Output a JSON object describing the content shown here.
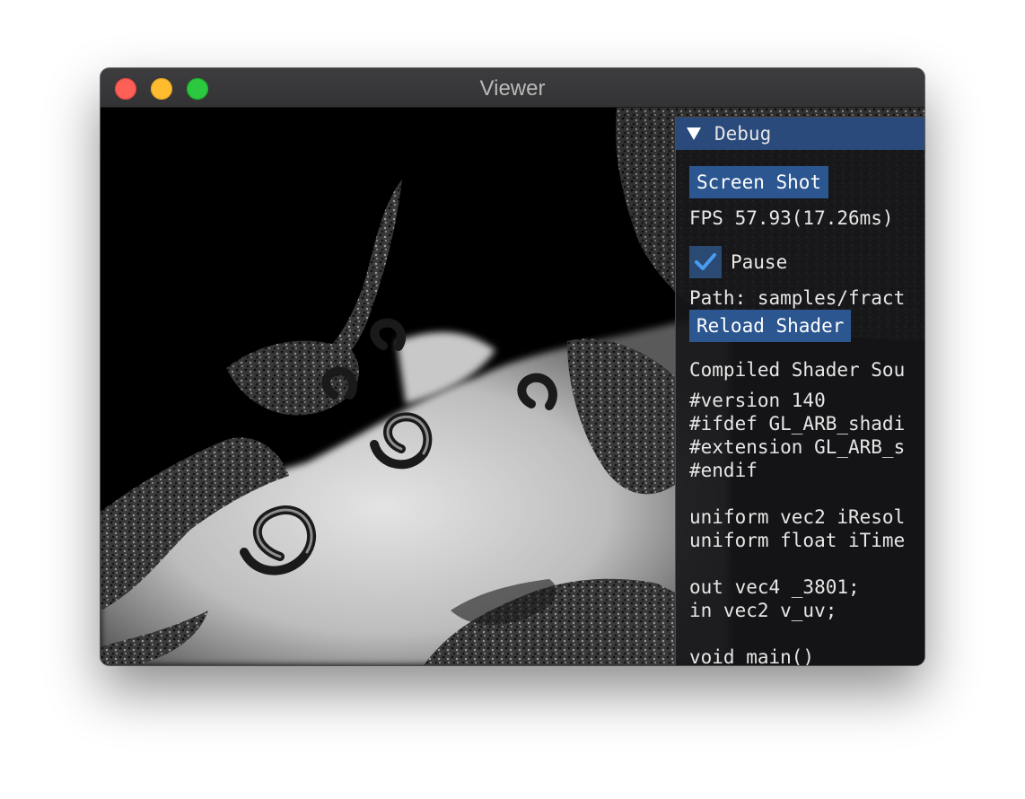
{
  "window": {
    "title": "Viewer"
  },
  "debug": {
    "header": "Debug",
    "screenshot_button": "Screen Shot",
    "fps_text": "FPS 57.93(17.26ms)",
    "pause_label": "Pause",
    "pause_checked": true,
    "path_text": "Path: samples/fract",
    "reload_button": "Reload Shader",
    "compiled_label": "Compiled Shader Sou",
    "source_lines": [
      "#version 140",
      "#ifdef GL_ARB_shadi",
      "#extension GL_ARB_s",
      "#endif",
      "",
      "uniform vec2 iResol",
      "uniform float iTime",
      "",
      "out vec4 _3801;",
      "in vec2 v_uv;",
      "",
      "void main()"
    ]
  },
  "colors": {
    "header_bg": "#294a7a",
    "button_bg": "#2b5690",
    "check_color": "#4a9cf0"
  },
  "icons": {
    "collapse": "triangle-down-icon",
    "checkmark": "checkmark-icon"
  }
}
